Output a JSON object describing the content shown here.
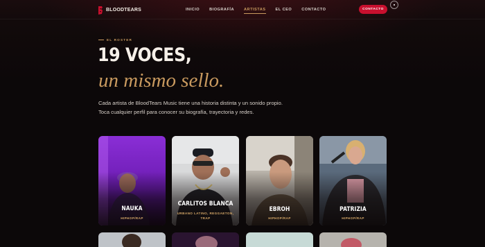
{
  "nav": {
    "logo": "BLOODTEARS",
    "links": [
      "INICIO",
      "BIOGRAFÍA",
      "ARTISTAS",
      "EL CEO",
      "CONTACTO"
    ],
    "active_index": 2,
    "contact_button": "CONTACTO"
  },
  "hero": {
    "eyebrow": "EL ROSTER",
    "title": "19 VOCES,",
    "subtitle": "un mismo sello.",
    "intro_line1": "Cada artista de BloodTears Music tiene una historia distinta y un sonido propio.",
    "intro_line2": "Toca cualquier perfil para conocer su biografía, trayectoria y redes."
  },
  "artists": [
    {
      "name": "NAUKA",
      "genre": "HIPHOP/RAP"
    },
    {
      "name": "CARLITOS BLANCA",
      "genre": "URBANO LATINO, REGGAETON, TRAP"
    },
    {
      "name": "EBROH",
      "genre": "HIPHOP/RAP"
    },
    {
      "name": "PATRIZIA",
      "genre": "HIPHOP/RAP"
    }
  ],
  "colors": {
    "accent_gold": "#c99a5f",
    "brand_red": "#c8102e",
    "background": "#0c0809"
  },
  "icons": {
    "logo": "blood-drop-logo-icon",
    "menu": "menu-dot-icon"
  }
}
